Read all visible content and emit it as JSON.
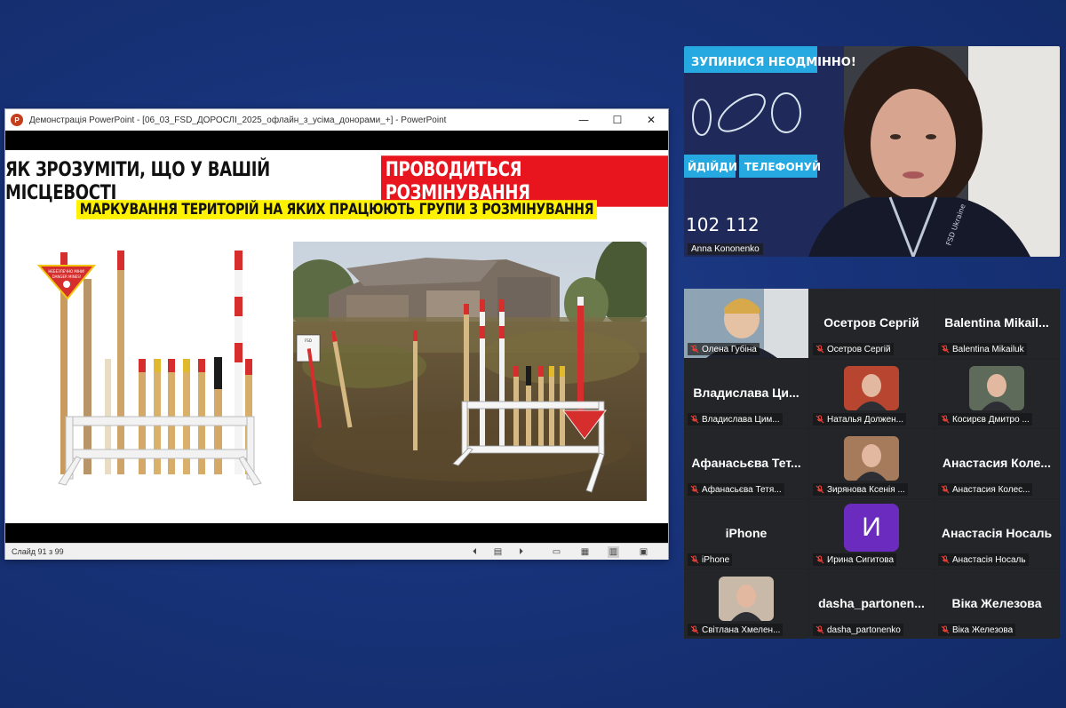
{
  "ppt": {
    "window_title": "Демонстрація PowerPoint - [06_03_FSD_ДОРОСЛІ_2025_офлайн_з_усіма_донорами_+] - PowerPoint",
    "app_icon_letter": "P",
    "controls": {
      "minimize": "—",
      "maximize": "☐",
      "close": "✕"
    },
    "slide": {
      "title_black": "ЯК ЗРОЗУМІТИ, ЩО У ВАШІЙ МІСЦЕВОСТІ",
      "title_red": "ПРОВОДИТЬСЯ РОЗМІНУВАННЯ",
      "subtitle": "МАРКУВАННЯ ТЕРИТОРІЙ НА ЯКИХ ПРАЦЮЮТЬ ГРУПИ З РОЗМІНУВАННЯ",
      "sign_text_1": "НЕБЕЗПЕЧНО МІНИ!",
      "sign_text_2": "DANGER MINES!",
      "photo_sign_text": "FSD"
    },
    "status": {
      "slide_counter": "Слайд 91 з 99"
    }
  },
  "speaker": {
    "name": "Anna Kononenko",
    "banner_top": "ЗУПИНИСЯ НЕОДМІННО!",
    "banner_left": "ЙДІЙДИ",
    "banner_right": "ТЕЛЕФОНУЙ",
    "numbers": "102   112",
    "lanyard": "FSD Ukraine"
  },
  "participants": [
    {
      "big": "",
      "label": "Олена Губіна",
      "avatar": "photo"
    },
    {
      "big": "Осетров Сергій",
      "label": "Осетров Сергій"
    },
    {
      "big": "Balentina  Mikail...",
      "label": "Balentina Mikailuk"
    },
    {
      "big": "Владислава  Ци...",
      "label": "Владислава Цим..."
    },
    {
      "big": "",
      "label": "Наталья Должен...",
      "avatar": "photo"
    },
    {
      "big": "",
      "label": "Косирєв Дмитро ...",
      "avatar": "photo"
    },
    {
      "big": "Афанасьєва  Тет...",
      "label": "Афанасьєва Тетя..."
    },
    {
      "big": "",
      "label": "Зирянова Ксенія ...",
      "avatar": "photo"
    },
    {
      "big": "Анастасия  Коле...",
      "label": "Анастасия Колес..."
    },
    {
      "big": "iPhone",
      "label": "iPhone"
    },
    {
      "big": "И",
      "label": "Ирина Сигитова",
      "avatar": "letter"
    },
    {
      "big": "Анастасія  Носаль",
      "label": "Анастасія Носаль"
    },
    {
      "big": "",
      "label": "Світлана Хмелен...",
      "avatar": "photo"
    },
    {
      "big": "dasha_partonen...",
      "label": "dasha_partonenko"
    },
    {
      "big": "Віка  Железова",
      "label": "Віка Железова"
    }
  ],
  "colors": {
    "background": "#18337a",
    "title_red": "#e8141e",
    "subtitle_yellow": "#fff200",
    "avatar_purple": "#6b2bbf",
    "mic_off_red": "#e5403a"
  }
}
